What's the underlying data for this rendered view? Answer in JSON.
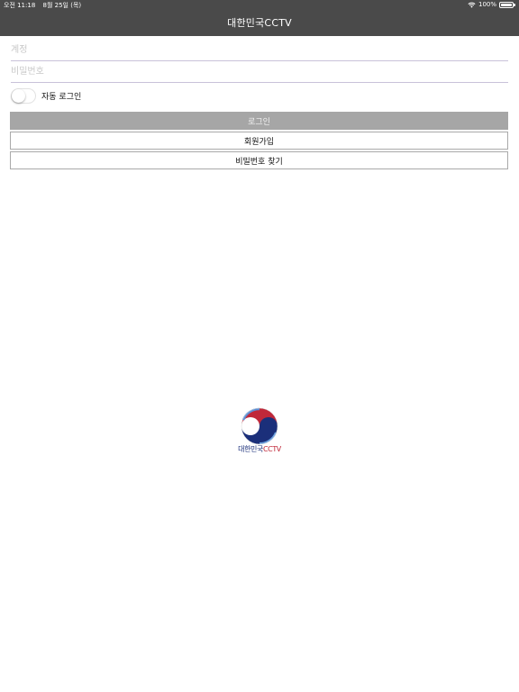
{
  "status_bar": {
    "time": "오전 11:18",
    "date": "8월 25일 (목)",
    "wifi_icon": "wifi-icon",
    "battery_percent": "100%",
    "battery_level": 1.0
  },
  "nav": {
    "title": "대한민국CCTV"
  },
  "form": {
    "account_placeholder": "계정",
    "account_value": "",
    "password_placeholder": "비밀번호",
    "password_value": "",
    "auto_login_label": "자동 로그인",
    "auto_login_on": false
  },
  "buttons": {
    "login": "로그인",
    "signup": "회원가입",
    "find_password": "비밀번호 찾기"
  },
  "logo": {
    "text_kr": "대한민국",
    "text_en": "CCTV"
  },
  "colors": {
    "nav_background": "#4a4a4a",
    "login_button": "#a6a6a6",
    "logo_blue": "#1b2f7a",
    "logo_red": "#c0283a"
  }
}
